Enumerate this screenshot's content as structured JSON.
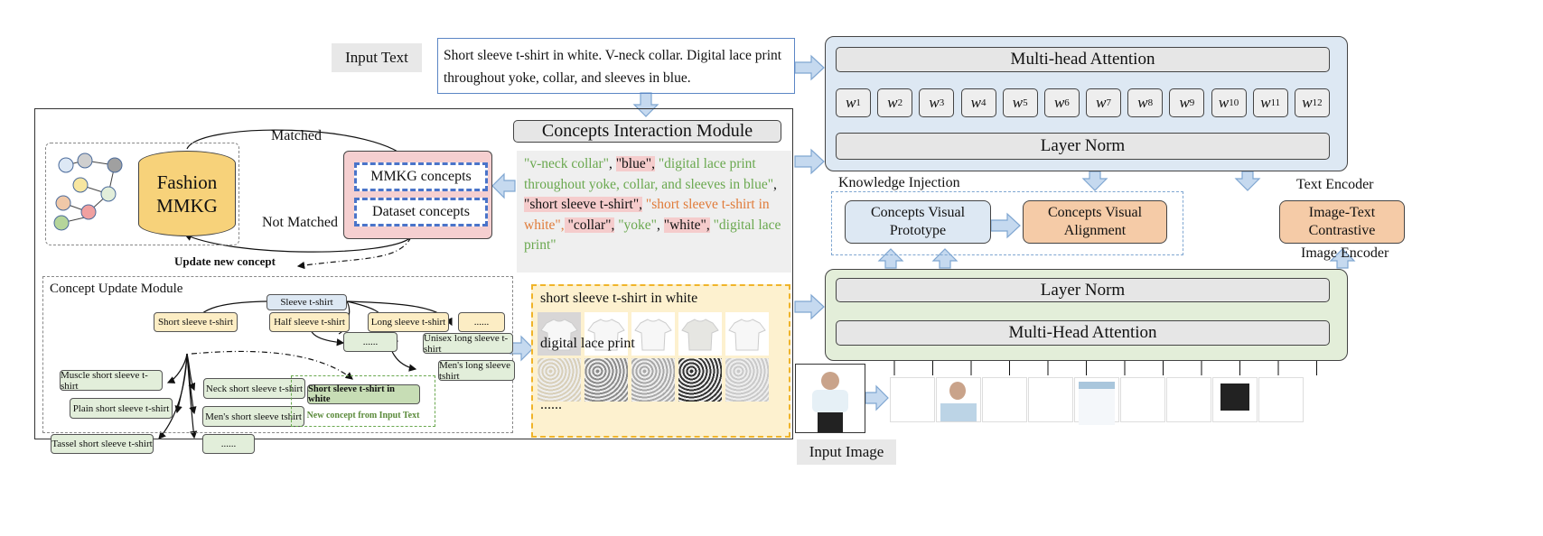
{
  "input_text": {
    "label": "Input Text",
    "text": "Short sleeve t-shirt in white. V-neck collar. Digital lace print throughout yoke, collar, and sleeves in blue."
  },
  "text_encoder": {
    "label": "Text Encoder",
    "attention": "Multi-head Attention",
    "norm": "Layer Norm",
    "weights": [
      "1",
      "2",
      "3",
      "4",
      "5",
      "6",
      "7",
      "8",
      "9",
      "10",
      "11",
      "12"
    ]
  },
  "image_encoder": {
    "label": "Image Encoder",
    "attention": "Multi-Head Attention",
    "norm": "Layer Norm"
  },
  "knowledge_injection": {
    "label": "Knowledge Injection",
    "prototype": "Concepts Visual Prototype",
    "alignment": "Concepts Visual Alignment"
  },
  "contrastive": "Image-Text Contrastive",
  "input_image": "Input Image",
  "cim": {
    "title": "Concepts Interaction Module",
    "concepts": [
      {
        "t": "\"v-neck collar\"",
        "c": "gr"
      },
      {
        "t": ", ",
        "c": ""
      },
      {
        "t": "\"blue\",",
        "c": "hl"
      },
      {
        "t": " \"digital lace print throughout yoke, collar, and sleeves in blue\"",
        "c": "gr"
      },
      {
        "t": ", ",
        "c": ""
      },
      {
        "t": "\"short sleeve t-shirt\",",
        "c": "hl"
      },
      {
        "t": " \"short sleeve t-shirt in white\",",
        "c": "or"
      },
      {
        "t": " \"collar\",",
        "c": "hl"
      },
      {
        "t": " \"yoke\"",
        "c": "gr"
      },
      {
        "t": ", ",
        "c": ""
      },
      {
        "t": "\"white\",",
        "c": "hl"
      },
      {
        "t": " \"digital lace print\"",
        "c": "gr"
      }
    ]
  },
  "mmkg": {
    "db": "Fashion MMKG",
    "matched": "Matched",
    "not_matched": "Not Matched",
    "mmkg_concepts": "MMKG concepts",
    "dataset_concepts": "Dataset concepts",
    "update": "Update new concept",
    "node_colors": [
      "#dde8f5",
      "#cfcfcf",
      "#a0a0a0",
      "#f7e6a0",
      "#e2eeda",
      "#f0c8a8",
      "#f0a0a0",
      "#b5d59a"
    ]
  },
  "cum": {
    "title": "Concept Update Module",
    "root": "Sleeve t-shirt",
    "level1": [
      "Short sleeve t-shirt",
      "Half sleeve t-shirt",
      "Long sleeve t-shirt",
      "......"
    ],
    "short_children": [
      "Muscle short sleeve t-shirt",
      "Plain short sleeve t-shirt",
      "Tassel short sleeve t-shirt",
      "Neck short sleeve t-shirt",
      "Men's short sleeve tshirt",
      "......"
    ],
    "half_children": [
      "......"
    ],
    "long_children": [
      "Unisex long sleeve t-shirt",
      "Men's long sleeve tshirt"
    ],
    "new_concept": "Short sleeve t-shirt in white",
    "new_label": "New concept from Input Text"
  },
  "prototypes": {
    "a": "short sleeve t-shirt in white",
    "b": "digital lace print",
    "more": "......"
  }
}
